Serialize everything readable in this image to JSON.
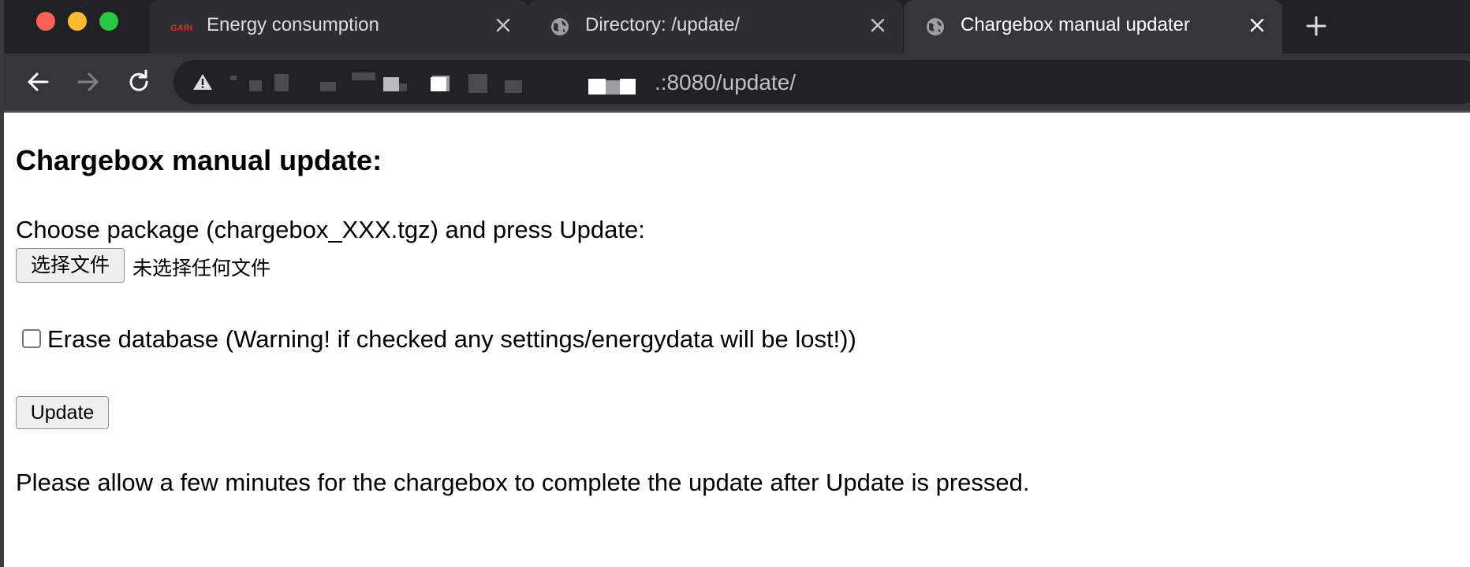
{
  "browser": {
    "tabs": [
      {
        "title": "Energy consumption",
        "icon": "garo-logo-icon",
        "active": false
      },
      {
        "title": "Directory: /update/",
        "icon": "globe-icon",
        "active": false
      },
      {
        "title": "Chargebox manual updater",
        "icon": "globe-icon",
        "active": true
      }
    ],
    "address_visible": ".:8080/update/",
    "security_icon": "warning-icon"
  },
  "page": {
    "heading": "Chargebox manual update:",
    "choose_label": "Choose package (chargebox_XXX.tgz) and press Update:",
    "file_button_label": "选择文件",
    "file_status": "未选择任何文件",
    "erase_label": "Erase database (Warning! if checked any settings/energydata will be lost!))",
    "erase_checked": false,
    "update_button_label": "Update",
    "note": "Please allow a few minutes for the chargebox to complete the update after Update is pressed."
  },
  "colors": {
    "tabstrip_bg": "#202124",
    "active_tab_bg": "#35363a",
    "garo_red": "#e3262f",
    "close_red": "#ff5f57",
    "minimize_yellow": "#febc2e",
    "zoom_green": "#28c840"
  }
}
